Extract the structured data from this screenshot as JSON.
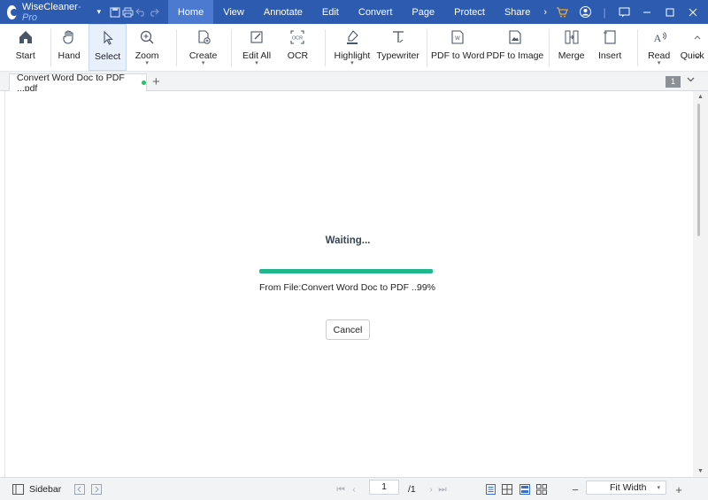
{
  "app": {
    "name": "WiseCleaner",
    "edition": "-Pro",
    "menu_caret": "▾"
  },
  "menu": {
    "items": [
      "Home",
      "View",
      "Annotate",
      "Edit",
      "Convert",
      "Page",
      "Protect",
      "Share"
    ],
    "active": "Home",
    "more": "›"
  },
  "ribbon": {
    "items": [
      {
        "label": "Start",
        "icon": "home-icon"
      },
      {
        "label": "Hand",
        "icon": "hand-icon"
      },
      {
        "label": "Select",
        "icon": "cursor-icon",
        "active": true
      },
      {
        "label": "Zoom",
        "icon": "zoom-icon",
        "dropdown": true
      },
      {
        "label": "Create",
        "icon": "create-icon",
        "dropdown": true
      },
      {
        "label": "Edit All",
        "icon": "edit-icon",
        "dropdown": true
      },
      {
        "label": "OCR",
        "icon": "ocr-icon"
      },
      {
        "label": "Highlight",
        "icon": "highlight-icon",
        "dropdown": true
      },
      {
        "label": "Typewriter",
        "icon": "typewriter-icon"
      },
      {
        "label": "PDF to Word",
        "icon": "pdf-to-word-icon"
      },
      {
        "label": "PDF to Image",
        "icon": "pdf-to-image-icon"
      },
      {
        "label": "Merge",
        "icon": "merge-icon"
      },
      {
        "label": "Insert",
        "icon": "insert-icon"
      },
      {
        "label": "Read",
        "icon": "read-icon",
        "dropdown": true
      },
      {
        "label": "Quick",
        "icon": "quick-icon"
      }
    ]
  },
  "tabs": {
    "doc_title": "Convert Word Doc to PDF ...pdf",
    "new_tab": "+",
    "page_count": "1"
  },
  "progress": {
    "title": "Waiting...",
    "file_label": "From File:Convert Word Doc to PDF ...",
    "percent_label": "99%",
    "percent_value": 99,
    "cancel_label": "Cancel"
  },
  "statusbar": {
    "sidebar_label": "Sidebar",
    "page_current": "1",
    "page_total": "/1",
    "zoom_label": "Fit Width",
    "zoom_out": "−",
    "zoom_in": "+"
  },
  "colors": {
    "titlebar": "#2d5bb0",
    "progress": "#21b78c"
  }
}
